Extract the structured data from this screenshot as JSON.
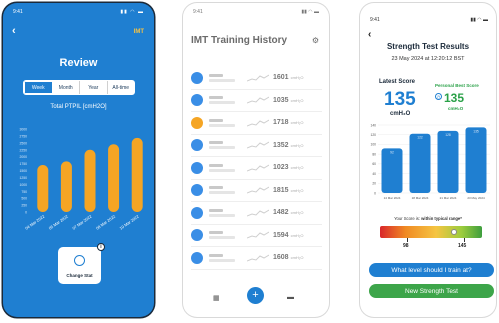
{
  "phone1": {
    "status_time": "9:41",
    "status_icons": "▮▮ ◠ ▬",
    "back_label": "‹",
    "brand": "IMT",
    "title": "Review",
    "segments": [
      "Week",
      "Month",
      "Year",
      "All-time"
    ],
    "active_segment": "Week",
    "chart_title": "Total PTPIL [cmH2O]",
    "change_stat_label": "Change Stat",
    "info_label": "i",
    "accent_color": "#f5a524",
    "chart_data": {
      "type": "bar",
      "title": "Total PTPIL [cmH2O]",
      "categories": [
        "04 Mar 2022",
        "05 Mar 2022",
        "07 Mar 2022",
        "08 Mar 2022",
        "10 Mar 2022"
      ],
      "values": [
        1700,
        1830,
        2250,
        2450,
        2680
      ],
      "yticks": [
        0,
        250,
        500,
        750,
        1000,
        1250,
        1500,
        1750,
        2000,
        2250,
        2500,
        2750,
        3000
      ],
      "ylim": [
        0,
        3000
      ]
    }
  },
  "phone2": {
    "status_time": "9:41",
    "status_icons": "▮▮ ◠ ▬",
    "title": "IMT Training History",
    "settings_icon": "gear-icon",
    "rows": [
      {
        "value": "1601",
        "unit": "cmH₂O",
        "color": "#3a8ee6"
      },
      {
        "value": "1035",
        "unit": "cmH₂O",
        "color": "#3a8ee6"
      },
      {
        "value": "1718",
        "unit": "cmH₂O",
        "color": "#f5a524"
      },
      {
        "value": "1352",
        "unit": "cmH₂O",
        "color": "#3a8ee6"
      },
      {
        "value": "1023",
        "unit": "cmH₂O",
        "color": "#3a8ee6"
      },
      {
        "value": "1815",
        "unit": "cmH₂O",
        "color": "#3a8ee6"
      },
      {
        "value": "1482",
        "unit": "cmH₂O",
        "color": "#3a8ee6"
      },
      {
        "value": "1594",
        "unit": "cmH₂O",
        "color": "#3a8ee6"
      },
      {
        "value": "1608",
        "unit": "cmH₂O",
        "color": "#3a8ee6"
      }
    ],
    "nav_left": "▦",
    "nav_center": "+",
    "nav_right": "▬"
  },
  "phone3": {
    "status_time": "9:41",
    "status_icons": "▮▮ ◠ ▬",
    "back_label": "‹",
    "title": "Strength Test Results",
    "date": "23 May 2024 at 12:20:12 BST",
    "latest_label": "Latest Score",
    "latest_value": "135",
    "latest_unit": "cmH₂O",
    "best_label": "Personal Best Score",
    "best_value": "135",
    "best_unit": "cmH₂O",
    "best_icon_glyph": "◷",
    "range_note_prefix": "Your Score is: ",
    "range_note_bold": "within typical range*",
    "range_low": "98",
    "range_high": "145",
    "score_fraction": 0.73,
    "btn_train": "What level should I train at?",
    "btn_new_test": "New Strength Test",
    "chart_data": {
      "type": "bar",
      "categories": [
        "14 Mar 2024",
        "18 Mar 2024",
        "21 Mar 2024",
        "23 May 2024"
      ],
      "values": [
        92,
        122,
        128,
        135
      ],
      "yticks": [
        0,
        20,
        40,
        60,
        80,
        100,
        120,
        140
      ],
      "ylim": [
        0,
        140
      ]
    }
  }
}
